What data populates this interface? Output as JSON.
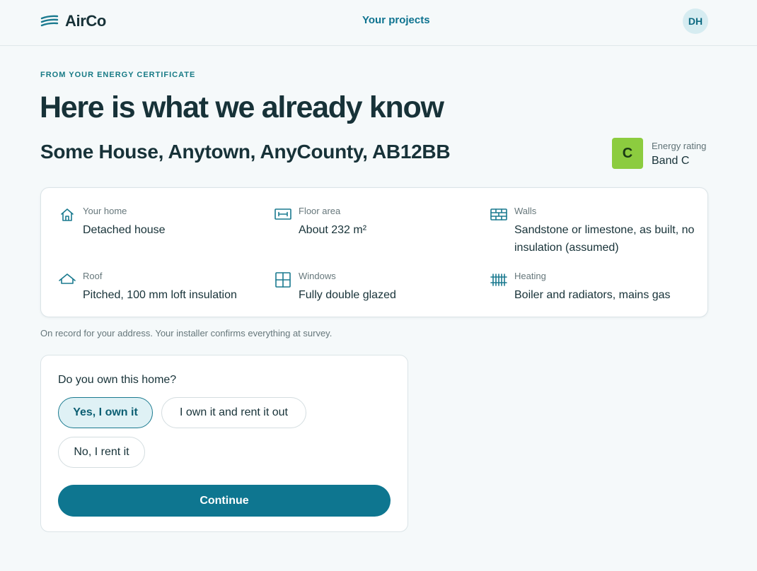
{
  "header": {
    "logo_text": "AirCo",
    "logo_icon": "wind-lines-icon",
    "nav_link": "Your projects",
    "avatar_initials": "DH"
  },
  "main": {
    "eyebrow": "FROM YOUR ENERGY CERTIFICATE",
    "title": "Here is what we already know",
    "address": "Some House, Anytown, AnyCounty, AB12BB",
    "energy_rating": {
      "band_letter": "C",
      "label": "Energy rating",
      "value": "Band C",
      "color": "#8ccc3f"
    }
  },
  "facts": [
    {
      "icon": "house-icon",
      "label": "Your home",
      "value": "Detached house"
    },
    {
      "icon": "floor-area-icon",
      "label": "Floor area",
      "value": "About 232 m²"
    },
    {
      "icon": "brick-wall-icon",
      "label": "Walls",
      "value": "Sandstone or limestone, as built, no insulation (assumed)"
    },
    {
      "icon": "roof-icon",
      "label": "Roof",
      "value": "Pitched, 100 mm loft insulation"
    },
    {
      "icon": "window-icon",
      "label": "Windows",
      "value": "Fully double glazed"
    },
    {
      "icon": "radiator-icon",
      "label": "Heating",
      "value": "Boiler and radiators, mains gas"
    }
  ],
  "note": "On record for your address. Your installer confirms everything at survey.",
  "ownership": {
    "question": "Do you own this home?",
    "options": [
      {
        "label": "Yes, I own it",
        "selected": true
      },
      {
        "label": "I own it and rent it out",
        "selected": false
      },
      {
        "label": "No, I rent it",
        "selected": false
      }
    ],
    "continue_label": "Continue"
  },
  "colors": {
    "accent": "#0e7690",
    "text": "#173238",
    "background": "#f5f9fa"
  }
}
